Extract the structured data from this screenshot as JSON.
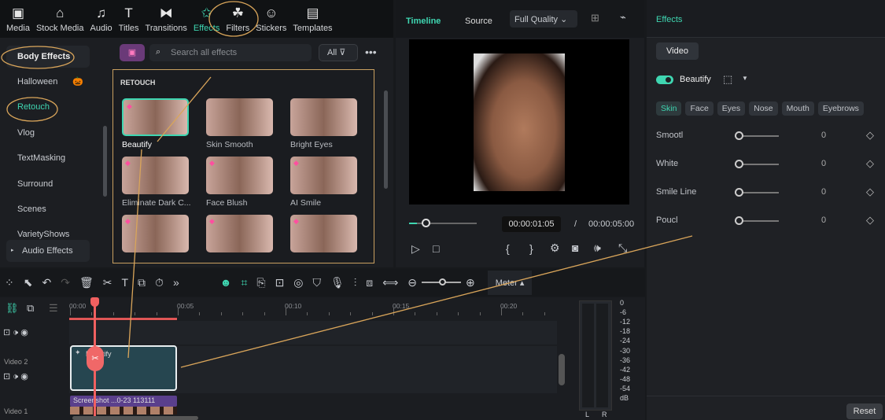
{
  "tabs": [
    {
      "label": "Media",
      "icon": "media-icon",
      "glyph": "▣"
    },
    {
      "label": "Stock Media",
      "icon": "stock-media-icon",
      "glyph": "⌂"
    },
    {
      "label": "Audio",
      "icon": "audio-icon",
      "glyph": "♫"
    },
    {
      "label": "Titles",
      "icon": "titles-icon",
      "glyph": "T"
    },
    {
      "label": "Transitions",
      "icon": "transitions-icon",
      "glyph": "⧓"
    },
    {
      "label": "Effects",
      "icon": "effects-icon",
      "glyph": "✩"
    },
    {
      "label": "Filters",
      "icon": "filters-icon",
      "glyph": "☘"
    },
    {
      "label": "Stickers",
      "icon": "stickers-icon",
      "glyph": "☺"
    },
    {
      "label": "Templates",
      "icon": "templates-icon",
      "glyph": "▤"
    }
  ],
  "sidebar": [
    "Body Effects",
    "Halloween",
    "Retouch",
    "Vlog",
    "TextMasking",
    "Surround",
    "Scenes",
    "VarietyShows",
    "Audio Effects"
  ],
  "halloween_icon": "🎃",
  "search": {
    "placeholder": "Search all effects",
    "filter": "All"
  },
  "grid": {
    "section": "RETOUCH",
    "items": [
      "Beautify",
      "Skin Smooth",
      "Bright Eyes",
      "Eliminate Dark C...",
      "Face Blush",
      "AI Smile",
      "",
      "",
      ""
    ]
  },
  "player": {
    "tabs": [
      "Timeline",
      "Source"
    ],
    "quality": "Full Quality",
    "current": "00:00:01:05",
    "sep": "/",
    "total": "00:00:05:00",
    "progress": 0.12
  },
  "right": {
    "title": "Effects",
    "tab": "Video",
    "effect": "Beautify",
    "enabled": true,
    "chips": [
      "Skin",
      "Face",
      "Eyes",
      "Nose",
      "Mouth",
      "Eyebrows"
    ],
    "params": [
      {
        "name": "Smootl",
        "value": "0"
      },
      {
        "name": "White",
        "value": "0"
      },
      {
        "name": "Smile Line",
        "value": "0"
      },
      {
        "name": "Poucl",
        "value": "0"
      }
    ],
    "reset": "Reset"
  },
  "timeline": {
    "meter": "Meter",
    "ruler": [
      "00:00",
      "00:05",
      "00:10",
      "00:15",
      "00:20"
    ],
    "tracks": [
      "Video 2",
      "Video 1"
    ],
    "effect_clip": "Beautify",
    "video_clip": "Screenshot ...0-23 113111",
    "db": [
      "0",
      "-6",
      "-12",
      "-18",
      "-24",
      "-30",
      "-36",
      "-42",
      "-48",
      "-54",
      "dB"
    ],
    "lr": [
      "L",
      "R"
    ]
  },
  "accent": "#3fd6b1"
}
